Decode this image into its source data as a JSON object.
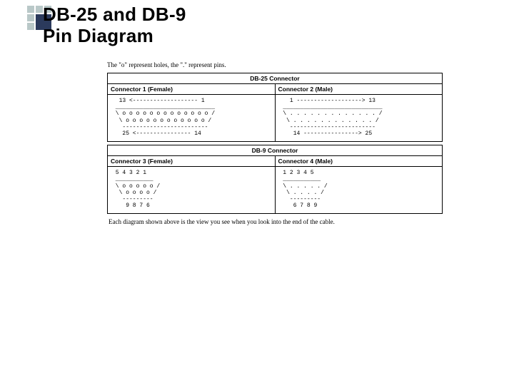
{
  "title_line1": "DB-25 and DB-9",
  "title_line2": "Pin Diagram",
  "legend": "The \"o\" represent holes, the \".\" represent pins.",
  "db25": {
    "caption": "DB-25 Connector",
    "left_header": "Connector 1 (Female)",
    "right_header": "Connector 2 (Male)",
    "left_ascii": "  13 <------------------- 1\n _____________________________\n \\ o o o o o o o o o o o o o /\n  \\ o o o o o o o o o o o o /\n   -------------------------\n   25 <---------------- 14",
    "right_ascii": "   1 -------------------> 13\n _____________________________\n \\ . . . . . . . . . . . . . /\n  \\ . . . . . . . . . . . . /\n   -------------------------\n    14 ----------------> 25"
  },
  "db9": {
    "caption": "DB-9 Connector",
    "left_header": "Connector 3 (Female)",
    "right_header": "Connector 4 (Male)",
    "left_ascii": " 5 4 3 2 1\n ___________\n \\ o o o o o /\n  \\ o o o o /\n   ---------\n    9 8 7 6",
    "right_ascii": " 1 2 3 4 5\n ___________\n \\ . . . . . /\n  \\ . . . . /\n   ---------\n    6 7 8 9"
  },
  "footnote": "Each diagram shown above is the view you see when you look into the end of the cable."
}
